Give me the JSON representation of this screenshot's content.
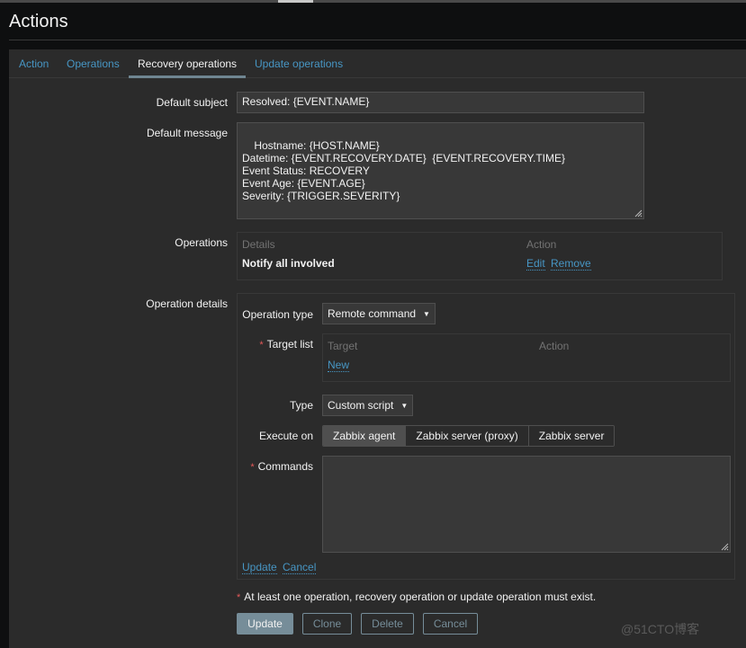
{
  "page": {
    "title": "Actions"
  },
  "tabs": [
    {
      "label": "Action",
      "active": false
    },
    {
      "label": "Operations",
      "active": false
    },
    {
      "label": "Recovery operations",
      "active": true
    },
    {
      "label": "Update operations",
      "active": false
    }
  ],
  "form": {
    "default_subject": {
      "label": "Default subject",
      "value": "Resolved: {EVENT.NAME}"
    },
    "default_message": {
      "label": "Default message",
      "value": "Hostname: {HOST.NAME}\nDatetime: {EVENT.RECOVERY.DATE}  {EVENT.RECOVERY.TIME}\nEvent Status: RECOVERY\nEvent Age: {EVENT.AGE}\nSeverity: {TRIGGER.SEVERITY}"
    },
    "operations": {
      "label": "Operations",
      "columns": [
        "Details",
        "Action"
      ],
      "rows": [
        {
          "details": "Notify all involved",
          "actions": [
            "Edit",
            "Remove"
          ]
        }
      ]
    },
    "operation_details": {
      "label": "Operation details",
      "operation_type": {
        "label": "Operation type",
        "value": "Remote command"
      },
      "target_list": {
        "label": "Target list",
        "required": true,
        "columns": [
          "Target",
          "Action"
        ],
        "new_link": "New"
      },
      "type": {
        "label": "Type",
        "value": "Custom script"
      },
      "execute_on": {
        "label": "Execute on",
        "options": [
          "Zabbix agent",
          "Zabbix server (proxy)",
          "Zabbix server"
        ],
        "selected": "Zabbix agent"
      },
      "commands": {
        "label": "Commands",
        "required": true,
        "value": ""
      },
      "links": {
        "update": "Update",
        "cancel": "Cancel"
      }
    },
    "notice": "At least one operation, recovery operation or update operation must exist."
  },
  "buttons": {
    "update": "Update",
    "clone": "Clone",
    "delete": "Delete",
    "cancel": "Cancel"
  },
  "watermark": "@51CTO博客",
  "colors": {
    "link": "#4796c4",
    "required": "#e45959",
    "primary_button": "#768d99",
    "background": "#2b2b2b"
  }
}
